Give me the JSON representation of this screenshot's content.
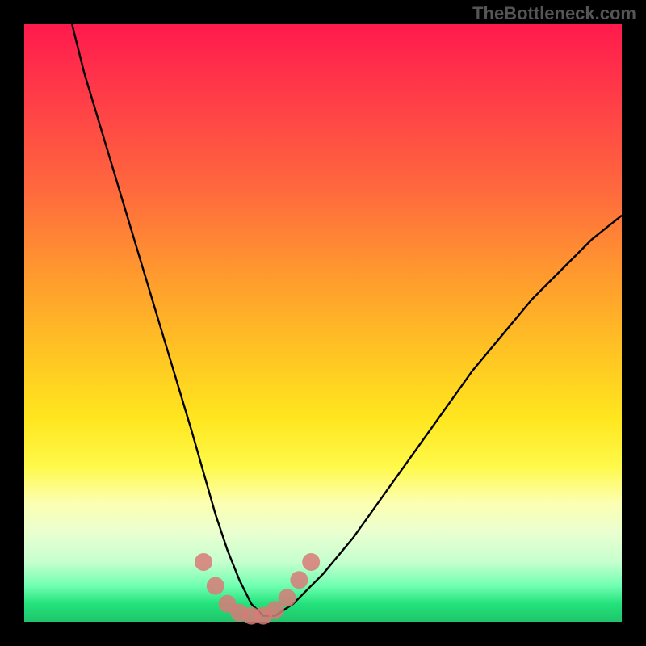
{
  "watermark": "TheBottleneck.com",
  "chart_data": {
    "type": "line",
    "title": "",
    "xlabel": "",
    "ylabel": "",
    "xlim": [
      0,
      100
    ],
    "ylim": [
      0,
      100
    ],
    "series": [
      {
        "name": "bottleneck-curve",
        "x": [
          8,
          10,
          13,
          16,
          19,
          22,
          25,
          28,
          30,
          32,
          34,
          36,
          38,
          40,
          42,
          45,
          50,
          55,
          60,
          65,
          70,
          75,
          80,
          85,
          90,
          95,
          100
        ],
        "y": [
          100,
          92,
          82,
          72,
          62,
          52,
          42,
          32,
          25,
          18,
          12,
          7,
          3,
          1,
          1,
          3,
          8,
          14,
          21,
          28,
          35,
          42,
          48,
          54,
          59,
          64,
          68
        ]
      }
    ],
    "markers": {
      "name": "highlight-points",
      "color": "#d97a78",
      "points": [
        {
          "x": 30,
          "y": 10
        },
        {
          "x": 32,
          "y": 6
        },
        {
          "x": 34,
          "y": 3
        },
        {
          "x": 36,
          "y": 1.5
        },
        {
          "x": 38,
          "y": 1
        },
        {
          "x": 40,
          "y": 1
        },
        {
          "x": 42,
          "y": 2
        },
        {
          "x": 44,
          "y": 4
        },
        {
          "x": 46,
          "y": 7
        },
        {
          "x": 48,
          "y": 10
        }
      ]
    },
    "background_gradient": {
      "top": "#ff1a4d",
      "mid": "#ffe61f",
      "bottom": "#1fc46b"
    }
  }
}
